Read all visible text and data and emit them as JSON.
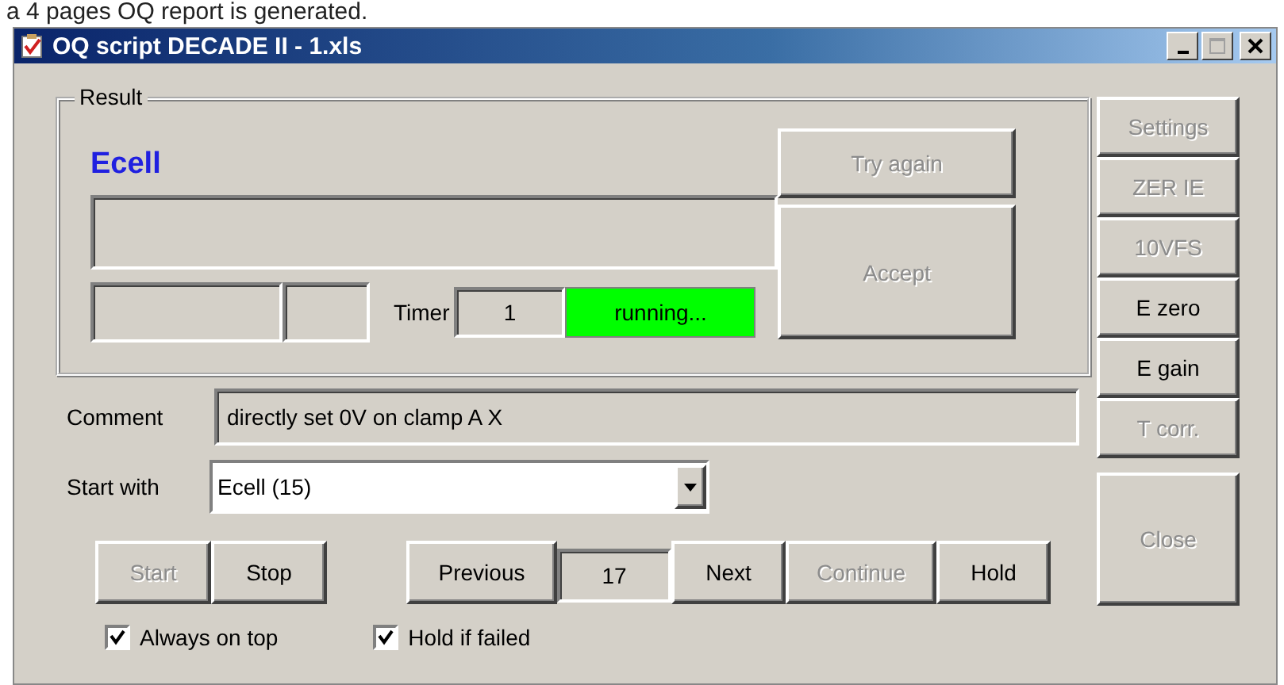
{
  "caption": "a 4 pages OQ report is generated.",
  "window": {
    "title": "OQ script DECADE II - 1.xls"
  },
  "result": {
    "label": "Result",
    "test_name": "Ecell",
    "timer_label": "Timer",
    "timer_value": "1",
    "status": "running...",
    "try_again": {
      "label": "Try again",
      "disabled": true
    },
    "accept": {
      "label": "Accept",
      "disabled": true
    }
  },
  "side_buttons": [
    {
      "label": "Settings",
      "disabled": true
    },
    {
      "label": "ZER IE",
      "disabled": true
    },
    {
      "label": "10VFS",
      "disabled": true
    },
    {
      "label": "E zero",
      "disabled": false
    },
    {
      "label": "E gain",
      "disabled": false
    },
    {
      "label": "T corr.",
      "disabled": true
    }
  ],
  "close_button": {
    "label": "Close",
    "disabled": true
  },
  "comment": {
    "label": "Comment",
    "value": "directly set 0V on clamp A X"
  },
  "start_with": {
    "label": "Start with",
    "value": "Ecell (15)"
  },
  "run_buttons": [
    {
      "label": "Start",
      "disabled": true
    },
    {
      "label": "Stop",
      "disabled": false
    }
  ],
  "navigation": {
    "previous": {
      "label": "Previous",
      "disabled": false
    },
    "step": "17",
    "next": {
      "label": "Next",
      "disabled": false
    },
    "continue": {
      "label": "Continue",
      "disabled": true
    },
    "hold": {
      "label": "Hold",
      "disabled": false
    }
  },
  "checkboxes": [
    {
      "label": "Always on top",
      "checked": true
    },
    {
      "label": "Hold if failed",
      "checked": true
    }
  ]
}
